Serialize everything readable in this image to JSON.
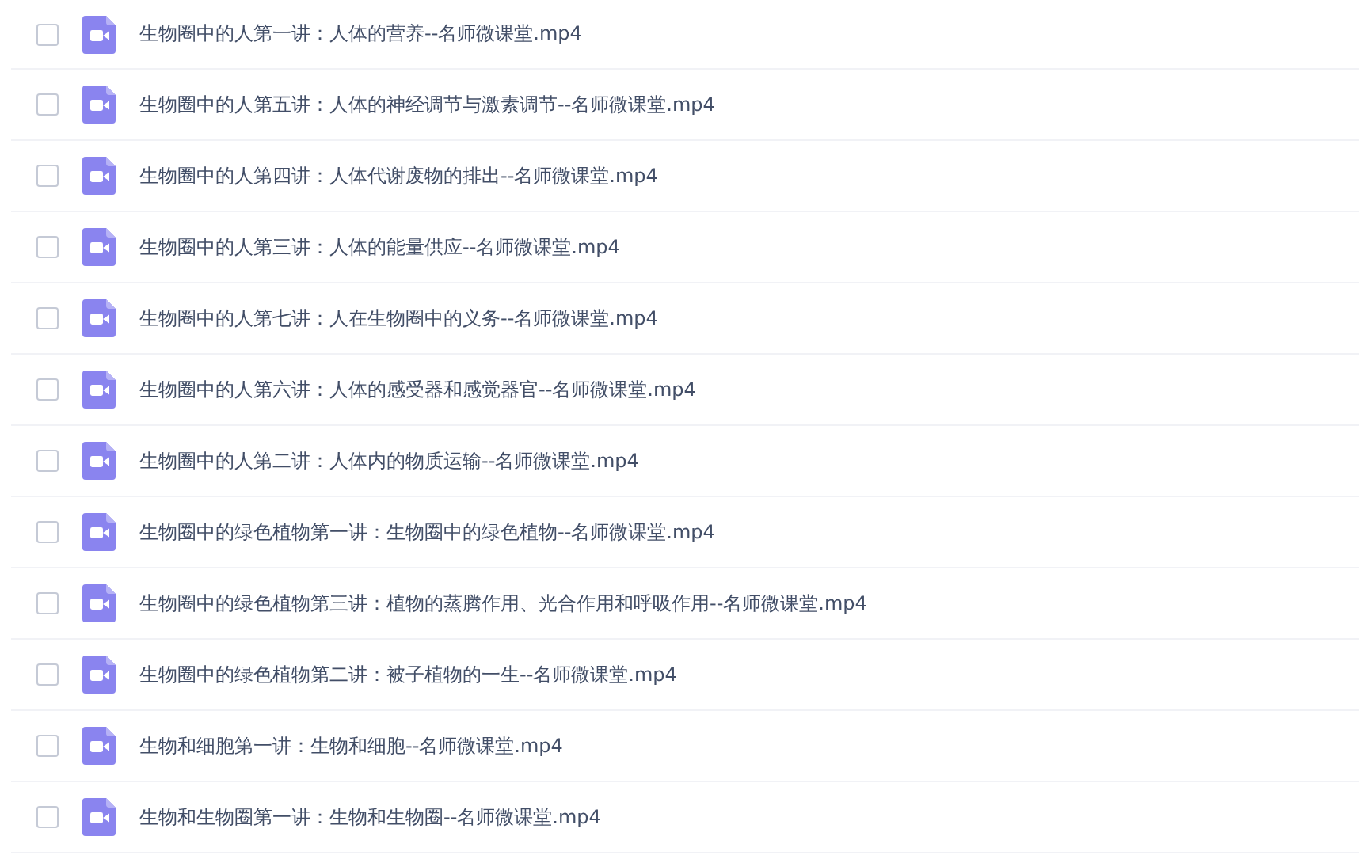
{
  "files": [
    {
      "name": "生物圈中的人第一讲：人体的营养--名师微课堂.mp4",
      "checked": false
    },
    {
      "name": "生物圈中的人第五讲：人体的神经调节与激素调节--名师微课堂.mp4",
      "checked": false
    },
    {
      "name": "生物圈中的人第四讲：人体代谢废物的排出--名师微课堂.mp4",
      "checked": false
    },
    {
      "name": "生物圈中的人第三讲：人体的能量供应--名师微课堂.mp4",
      "checked": false
    },
    {
      "name": "生物圈中的人第七讲：人在生物圈中的义务--名师微课堂.mp4",
      "checked": false
    },
    {
      "name": "生物圈中的人第六讲：人体的感受器和感觉器官--名师微课堂.mp4",
      "checked": false
    },
    {
      "name": "生物圈中的人第二讲：人体内的物质运输--名师微课堂.mp4",
      "checked": false
    },
    {
      "name": "生物圈中的绿色植物第一讲：生物圈中的绿色植物--名师微课堂.mp4",
      "checked": false
    },
    {
      "name": "生物圈中的绿色植物第三讲：植物的蒸腾作用、光合作用和呼吸作用--名师微课堂.mp4",
      "checked": false
    },
    {
      "name": "生物圈中的绿色植物第二讲：被子植物的一生--名师微课堂.mp4",
      "checked": false
    },
    {
      "name": "生物和细胞第一讲：生物和细胞--名师微课堂.mp4",
      "checked": false
    },
    {
      "name": "生物和生物圈第一讲：生物和生物圈--名师微课堂.mp4",
      "checked": false
    }
  ]
}
